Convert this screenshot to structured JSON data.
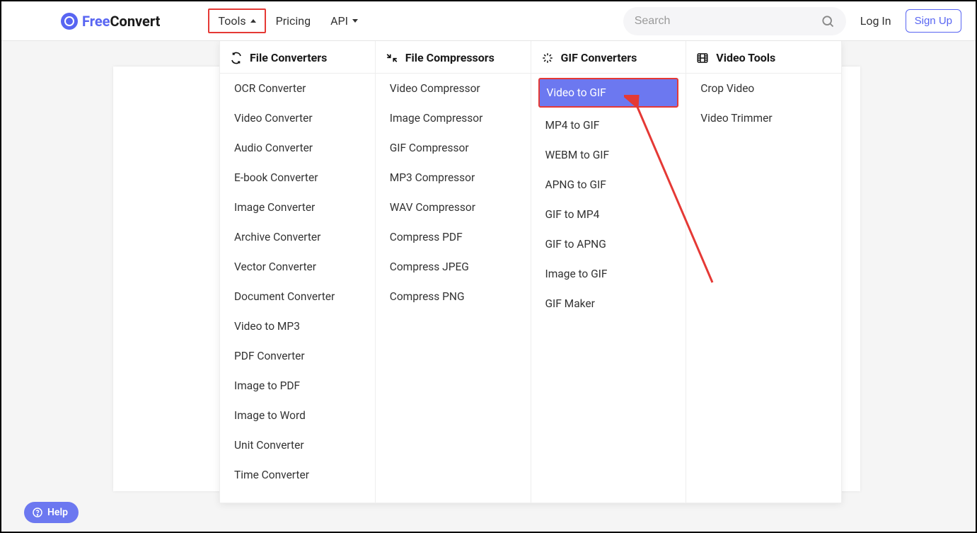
{
  "header": {
    "logo_free": "Free",
    "logo_convert": "Convert",
    "nav": {
      "tools": "Tools",
      "pricing": "Pricing",
      "api": "API"
    },
    "search_placeholder": "Search",
    "login": "Log In",
    "signup": "Sign Up"
  },
  "menu": {
    "columns": {
      "converters": {
        "title": "File Converters",
        "items": [
          "OCR Converter",
          "Video Converter",
          "Audio Converter",
          "E-book Converter",
          "Image Converter",
          "Archive Converter",
          "Vector Converter",
          "Document Converter",
          "Video to MP3",
          "PDF Converter",
          "Image to PDF",
          "Image to Word",
          "Unit Converter",
          "Time Converter"
        ]
      },
      "compressors": {
        "title": "File Compressors",
        "items": [
          "Video Compressor",
          "Image Compressor",
          "GIF Compressor",
          "MP3 Compressor",
          "WAV Compressor",
          "Compress PDF",
          "Compress JPEG",
          "Compress PNG"
        ]
      },
      "gif": {
        "title": "GIF Converters",
        "items": [
          "Video to GIF",
          "MP4 to GIF",
          "WEBM to GIF",
          "APNG to GIF",
          "GIF to MP4",
          "GIF to APNG",
          "Image to GIF",
          "GIF Maker"
        ]
      },
      "video": {
        "title": "Video Tools",
        "items": [
          "Crop Video",
          "Video Trimmer"
        ]
      }
    }
  },
  "help": "Help"
}
